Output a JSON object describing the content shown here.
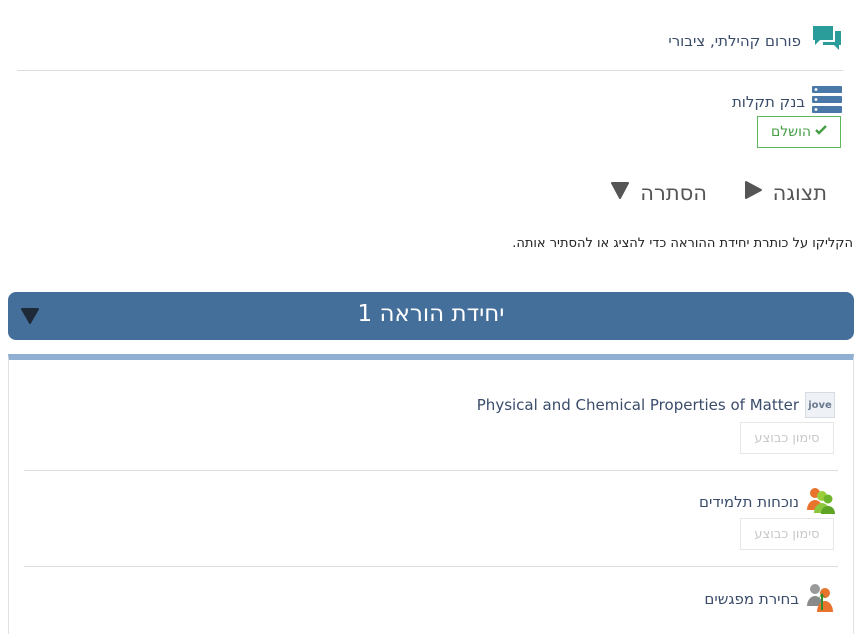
{
  "forum": {
    "label": "פורום קהילתי, ציבורי",
    "icon": "forum-chat-icon"
  },
  "bank": {
    "label": "בנק תקלות",
    "icon": "database-icon"
  },
  "completed_button": {
    "label": "הושלם",
    "icon": "check-icon",
    "color": "#5cb85c"
  },
  "view_controls": {
    "show_label": "תצוגה",
    "hide_label": "הסתרה"
  },
  "hint_text": "הקליקו על כותרת יחידת ההוראה כדי להציג או להסתיר אותה.",
  "unit": {
    "title": "יחידת הוראה 1",
    "color": "#456f9b",
    "accent": "#8fb0d3"
  },
  "activities": [
    {
      "title": "Physical and Chemical Properties of Matter",
      "badge": "jove",
      "icon": "jove-icon",
      "mark_label": "סימון כבוצע"
    },
    {
      "title": "נוכחות תלמידים",
      "icon": "attendance-people-icon",
      "mark_label": "סימון כבוצע"
    },
    {
      "title": "בחירת מפגשים",
      "icon": "scheduler-people-icon"
    }
  ]
}
